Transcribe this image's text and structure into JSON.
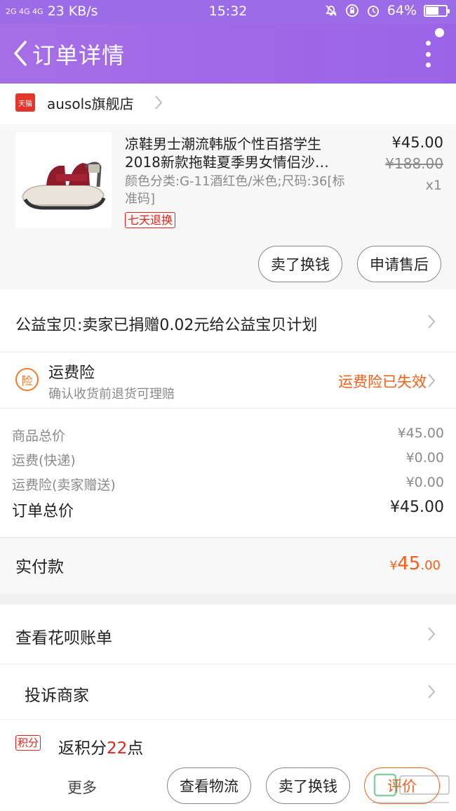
{
  "status_bar": {
    "network": "2G 4G 4G",
    "speed": "23 KB/s",
    "time": "15:32",
    "battery": "64%",
    "battery_level": 0.64
  },
  "nav": {
    "title": "订单详情"
  },
  "shop": {
    "badge": "天猫",
    "name": "ausols旗舰店"
  },
  "product": {
    "title": "凉鞋男士潮流韩版个性百搭学生2018新款拖鞋夏季男女情侣沙…",
    "spec": "颜色分类:G-11酒红色/米色;尺码:36[标准码]",
    "tag": "七天退换",
    "price": "¥45.00",
    "original_price": "¥188.00",
    "quantity": "x1",
    "actions": [
      "卖了换钱",
      "申请售后"
    ]
  },
  "charity": {
    "text": "公益宝贝:卖家已捐赠0.02元给公益宝贝计划"
  },
  "insurance": {
    "icon_label": "险",
    "title": "运费险",
    "subtitle": "确认收货前退货可理赔",
    "status": "运费险已失效"
  },
  "summary": {
    "lines": [
      {
        "label": "商品总价",
        "value": "¥45.00"
      },
      {
        "label": "运费(快递)",
        "value": "¥0.00"
      },
      {
        "label": "运费险(卖家赠送)",
        "value": "¥0.00"
      }
    ],
    "total_label": "订单总价",
    "total_value": "¥45.00"
  },
  "paid": {
    "label": "实付款",
    "currency": "¥",
    "integer": "45",
    "decimal": ".00"
  },
  "menu": {
    "huabei": "查看花呗账单",
    "complain": "投诉商家"
  },
  "points": {
    "badge": "积分",
    "prefix": "返积分",
    "value": "22",
    "suffix": "点"
  },
  "bottom": {
    "more": "更多",
    "logistics": "查看物流",
    "resell": "卖了换钱",
    "rate": "评价"
  },
  "colors": {
    "purple": "#9b63e8",
    "orange": "#f2601b",
    "red": "#e0241a"
  }
}
